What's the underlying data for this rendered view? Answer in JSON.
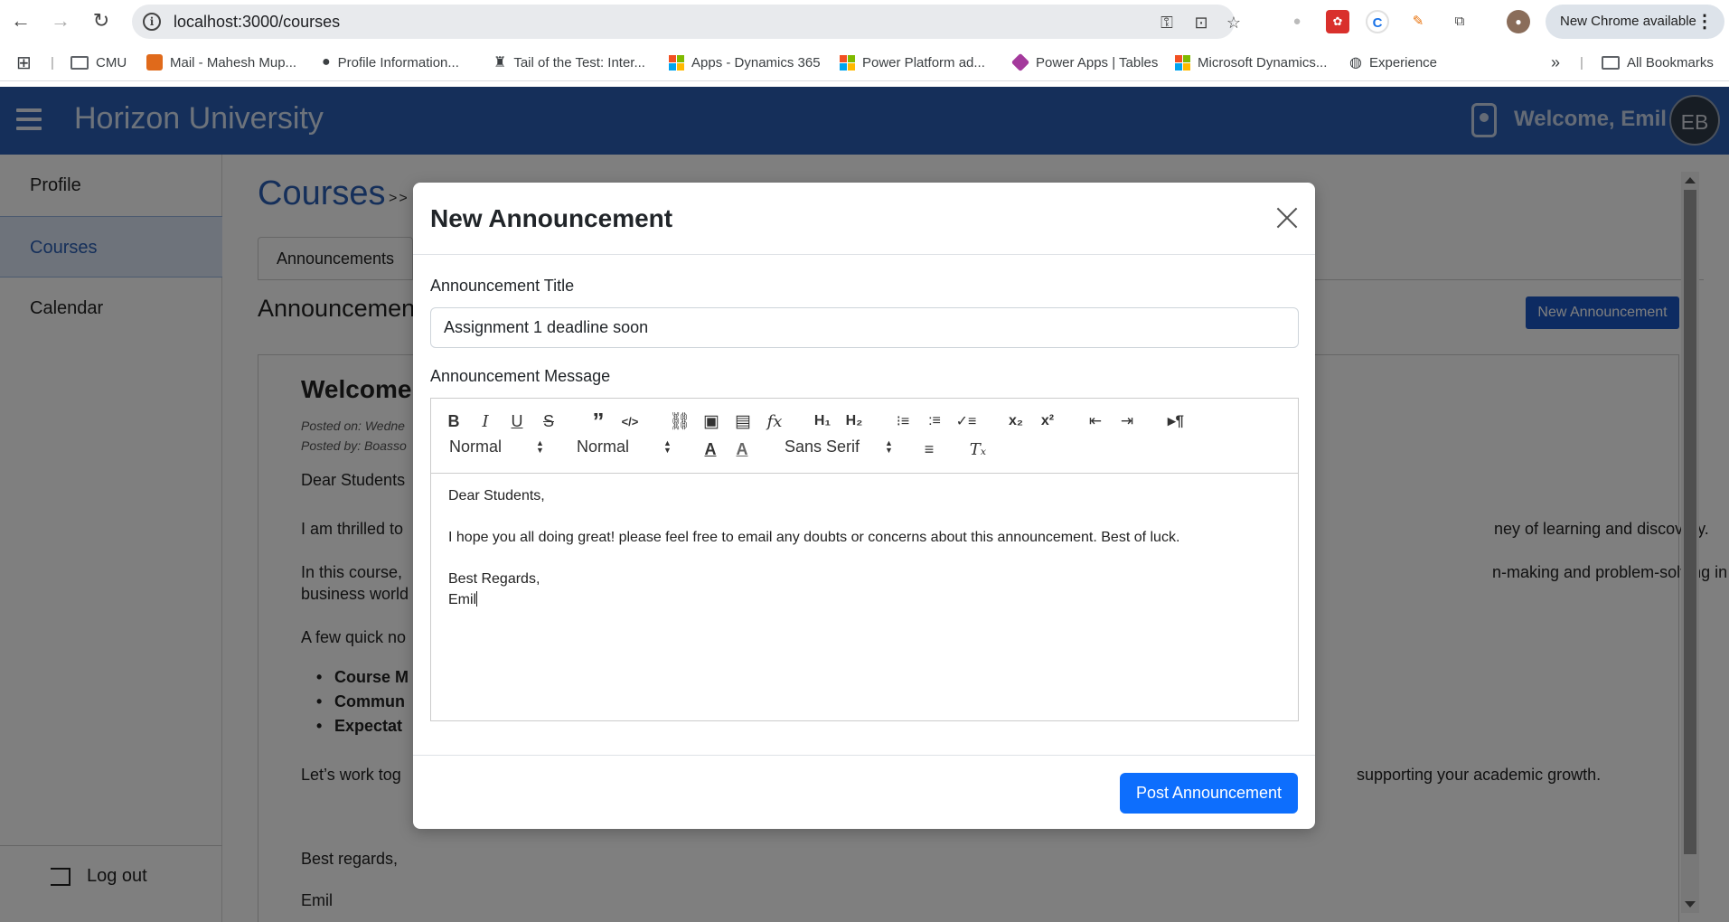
{
  "browser": {
    "url": "localhost:3000/courses",
    "update_label": "New Chrome available",
    "bookmarks": [
      {
        "label": "CMU",
        "icon": "folder-icon"
      },
      {
        "label": "Mail - Mahesh Mup...",
        "icon": "mail-icon"
      },
      {
        "label": "Profile Information...",
        "icon": "apple-icon"
      },
      {
        "label": "Tail of the Test: Inter...",
        "icon": "figure-icon"
      },
      {
        "label": "Apps - Dynamics 365",
        "icon": "microsoft-icon"
      },
      {
        "label": "Power Platform ad...",
        "icon": "microsoft-icon"
      },
      {
        "label": "Power Apps | Tables",
        "icon": "powerapps-icon"
      },
      {
        "label": "Microsoft Dynamics...",
        "icon": "microsoft-icon"
      },
      {
        "label": "Experience",
        "icon": "globe-icon"
      }
    ],
    "more_label": "»",
    "all_bookmarks": "All Bookmarks"
  },
  "app": {
    "title": "Horizon University",
    "welcome": "Welcome, Emil",
    "avatar_initials": "EB",
    "brand_color": "#2a5fb5"
  },
  "sidebar": {
    "items": [
      {
        "label": "Profile",
        "active": false
      },
      {
        "label": "Courses",
        "active": true
      },
      {
        "label": "Calendar",
        "active": false
      }
    ],
    "logout": "Log out"
  },
  "main": {
    "breadcrumb": "Courses",
    "breadcrumb_sep": ">>",
    "tab": "Announcements",
    "section_title": "Announcements",
    "new_button": "New Announcement",
    "card": {
      "title": "Welcome",
      "posted_on": "Posted on: Wedne",
      "posted_by": "Posted by: Boasso",
      "greeting": "Dear Students",
      "p1_start": "I am thrilled to",
      "p1_end": "ney of learning and discovery.",
      "p2_start": "In this course,",
      "p2_end": "n-making and problem-solving in the",
      "p2_line2": "business world",
      "p3": "A few quick no",
      "bullets": [
        "Course M",
        "Commun",
        "Expectat"
      ],
      "p4_start": "Let’s work tog",
      "p4_end": "supporting your academic growth.",
      "regards": "Best regards,",
      "signature": "Emil"
    }
  },
  "modal": {
    "title": "New Announcement",
    "title_label": "Announcement Title",
    "title_value": "Assignment 1 deadline soon",
    "message_label": "Announcement Message",
    "toolbar": {
      "header_select": "Normal",
      "size_select": "Normal",
      "font_select": "Sans Serif"
    },
    "message_lines": [
      "Dear Students,",
      "",
      "I hope you all doing great! please feel free to email any doubts or concerns about this announcement. Best of luck.",
      "",
      "Best Regards,",
      "Emil"
    ],
    "submit": "Post Announcement"
  }
}
